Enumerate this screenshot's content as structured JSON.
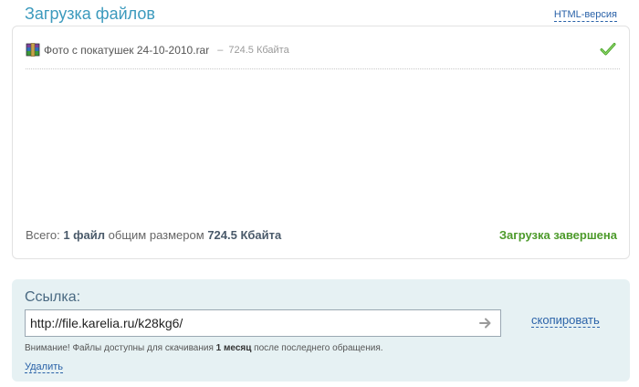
{
  "header": {
    "title": "Загрузка файлов",
    "html_version_label": "HTML-версия"
  },
  "upload": {
    "files": [
      {
        "name": "Фото с покатушек 24-10-2010.rar",
        "separator": "–",
        "size": "724.5 Кбайта",
        "icon": "winrar-archive-icon",
        "status_icon": "checkmark-icon"
      }
    ],
    "summary": {
      "prefix": "Всего:",
      "count": "1 файл",
      "middle": "общим размером",
      "total_size": "724.5 Кбайта"
    },
    "status_text": "Загрузка завершена"
  },
  "link_section": {
    "label": "Ссылка:",
    "url_value": "http://file.karelia.ru/k28kg6/",
    "copy_label": "скопировать",
    "notice_prefix": "Внимание! Файлы доступны для скачивания",
    "notice_bold": "1 месяц",
    "notice_suffix": "после последнего обращения.",
    "delete_label": "Удалить"
  },
  "colors": {
    "title": "#3c9abd",
    "link": "#2a62a8",
    "success": "#4c9a2a",
    "link_box_bg": "#e6f1f3"
  }
}
